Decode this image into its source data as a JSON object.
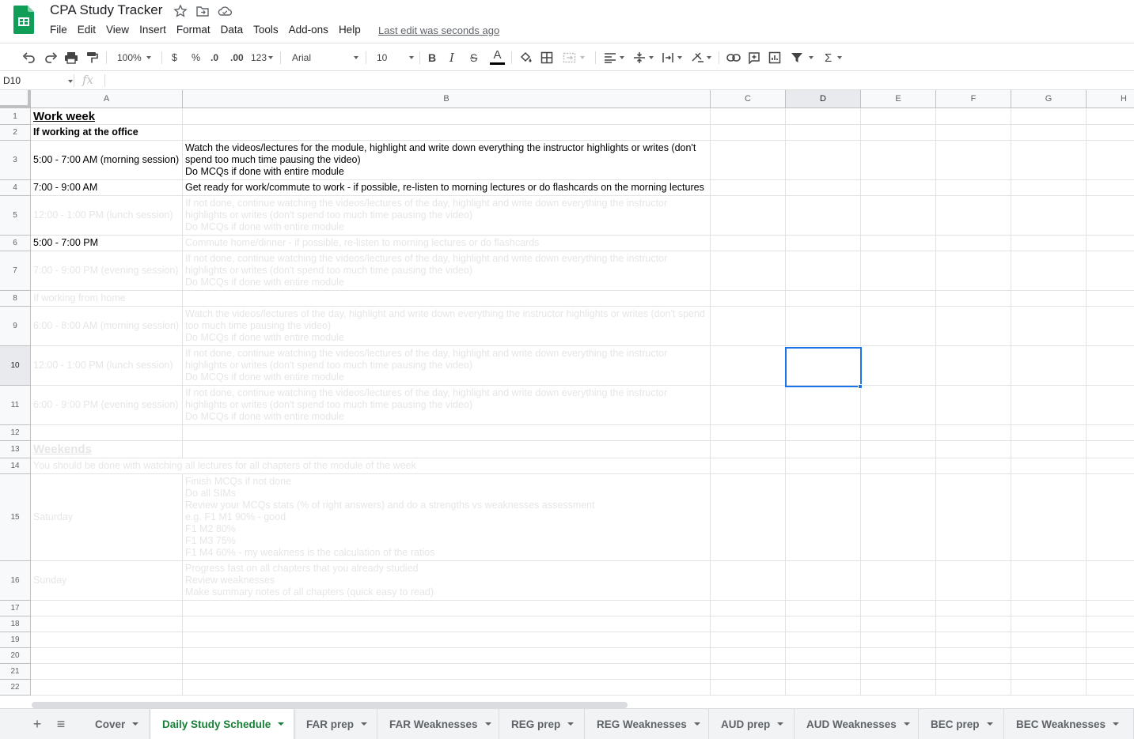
{
  "app": {
    "title": "CPA Study Tracker",
    "brand_color": "#0f9d58",
    "menu": [
      "File",
      "Edit",
      "View",
      "Insert",
      "Format",
      "Data",
      "Tools",
      "Add-ons",
      "Help"
    ],
    "last_edit": "Last edit was seconds ago"
  },
  "toolbar": {
    "zoom": "100%",
    "currency": "$",
    "percent": "%",
    "decrease_decimals": ".0",
    "increase_decimals": ".00",
    "more_formats": "123",
    "font": "Arial",
    "font_size": "10",
    "bold": "B",
    "italic": "I",
    "strikethrough": "S",
    "text_color": "A",
    "function": "Σ"
  },
  "formula_bar": {
    "name_box": "D10",
    "fx": "fx",
    "content": ""
  },
  "grid": {
    "columns": [
      "A",
      "B",
      "C",
      "D",
      "E",
      "F",
      "G",
      "H"
    ],
    "selected_column": "D",
    "selected_row": "10",
    "selected_cell": "D10",
    "rows": [
      {
        "n": "1",
        "a": "Work week",
        "b": ""
      },
      {
        "n": "2",
        "a": "If working at the office",
        "b": ""
      },
      {
        "n": "3",
        "a": "5:00 - 7:00 AM (morning session)",
        "b": "Watch the videos/lectures for the module, highlight and write down everything the instructor highlights or writes (don't spend too much time pausing the video)\nDo MCQs if done with entire module"
      },
      {
        "n": "4",
        "a": "7:00 - 9:00 AM",
        "b": "Get ready for work/commute to work - if possible, re-listen to morning lectures or do flashcards on the morning lectures"
      },
      {
        "n": "5",
        "a": "12:00 - 1:00 PM (lunch session)",
        "b": "If not done, continue watching the videos/lectures of the day, highlight and write down everything the instructor highlights or writes (don't spend too much time pausing the video)\nDo MCQs if done with entire module"
      },
      {
        "n": "6",
        "a": "5:00 - 7:00 PM",
        "b": "Commute home/dinner - if possible, re-listen to morning lectures or do flashcards"
      },
      {
        "n": "7",
        "a": "7:00 - 9:00 PM (evening session)",
        "b": "If not done, continue watching the videos/lectures of the day, highlight and write down everything the instructor highlights or writes (don't spend too much time pausing the video)\nDo MCQs if done with entire module"
      },
      {
        "n": "8",
        "a": "If working from home",
        "b": ""
      },
      {
        "n": "9",
        "a": "6:00 - 8:00 AM (morning session)",
        "b": "Watch the videos/lectures of the day, highlight and write down everything the instructor highlights or writes (don't spend too much time pausing the video)\nDo MCQs if done with entire module"
      },
      {
        "n": "10",
        "a": "12:00 - 1:00 PM (lunch session)",
        "b": "If not done, continue watching the videos/lectures of the day, highlight and write down everything the instructor highlights or writes (don't spend too much time pausing the video)\nDo MCQs if done with entire module"
      },
      {
        "n": "11",
        "a": "6:00 - 9:00 PM (evening session)",
        "b": "If not done, continue watching the videos/lectures of the day, highlight and write down everything the instructor highlights or writes (don't spend too much time pausing the video)\nDo MCQs if done with entire module"
      },
      {
        "n": "12",
        "a": "",
        "b": ""
      },
      {
        "n": "13",
        "a": "Weekends",
        "b": ""
      },
      {
        "n": "14",
        "a": "You should be done with watching all lectures for all chapters of the module of the week",
        "b": ""
      },
      {
        "n": "15",
        "a": "Saturday",
        "b": "Finish MCQs if not done\nDo all SIMs\nReview your MCQs stats (% of right answers) and do a strengths vs weaknesses assessment\ne.g. F1 M1 90% - good\nF1 M2 80%\nF1 M3 75%\nF1 M4 60% - my weakness is the calculation of the ratios"
      },
      {
        "n": "16",
        "a": "Sunday",
        "b": "Progress fast on all chapters that you already studied\nReview weaknesses\nMake summary notes of all chapters (quick easy to read)"
      },
      {
        "n": "17",
        "a": "",
        "b": ""
      },
      {
        "n": "18",
        "a": "",
        "b": ""
      },
      {
        "n": "19",
        "a": "",
        "b": ""
      },
      {
        "n": "20",
        "a": "",
        "b": ""
      },
      {
        "n": "21",
        "a": "",
        "b": ""
      },
      {
        "n": "22",
        "a": "",
        "b": ""
      }
    ]
  },
  "sheets": {
    "add_icon": "+",
    "list_icon": "≡",
    "tabs": [
      "Cover",
      "Daily Study Schedule",
      "FAR prep",
      "FAR Weaknesses",
      "REG prep",
      "REG Weaknesses",
      "AUD prep",
      "AUD Weaknesses",
      "BEC prep",
      "BEC Weaknesses"
    ],
    "active": "Daily Study Schedule"
  }
}
